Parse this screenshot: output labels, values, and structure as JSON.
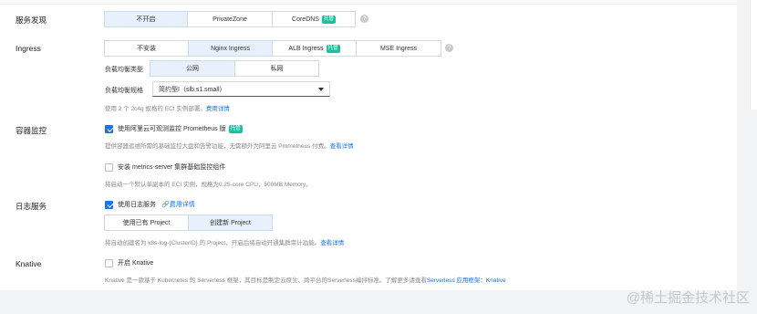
{
  "service_discovery": {
    "label": "服务发现",
    "options": [
      "不开启",
      "PrivateZone",
      "CoreDNS"
    ],
    "badge": "托管",
    "help": "?"
  },
  "ingress": {
    "label": "Ingress",
    "options": [
      "不安装",
      "Nginx Ingress",
      "ALB Ingress",
      "MSE Ingress"
    ],
    "badge": "托管",
    "help": "?",
    "lb_type_label": "负载均衡类型",
    "lb_type_options": [
      "公网",
      "私网"
    ],
    "lb_spec_label": "负载均衡规格",
    "lb_spec_value": "简约型I（slb.s1.small）",
    "note_prefix": "使用 2 个 2c4g 规格的 ECI 实例部署。",
    "note_link": "费用详情"
  },
  "monitoring": {
    "label": "容器监控",
    "prometheus_label": "使用阿里云可观测监控 Prometheus 版",
    "badge": "托管",
    "prometheus_desc": "提供容器运维所需的基础监控大盘和告警功能，无需额外为阿里云 Prometheus 付费。",
    "prometheus_link": "查看详情",
    "metrics_label": "安装 metrics-server 集群基础监控组件",
    "metrics_desc": "将启动一个默认单副本的 ECI 实例，规格为0.25-core CPU，500MB Memory。"
  },
  "logging": {
    "label": "日志服务",
    "enable_label": "使用日志服务",
    "cost_link": "费用详情",
    "project_options": [
      "使用已有 Project",
      "创建新 Project"
    ],
    "desc": "将自动创建名为 k8s-log-{ClusterID} 的 Project，开启后将自动开通集群审计功能。",
    "desc_link": "查看详情"
  },
  "knative": {
    "label": "Knative",
    "enable_label": "开启 Knative",
    "desc": "Knative 是一款基于 Kubernetes 的 Serverless 框架，其目标是制定云原生、跨平台的Serverless编排标准。了解更多请查看",
    "desc_link": "Serverless 应用框架：Knative"
  },
  "watermark": "@稀土掘金技术社区",
  "colors": {
    "accent": "#1a73e8",
    "badge": "#19c29e",
    "active_bg": "#e8f1fb"
  }
}
